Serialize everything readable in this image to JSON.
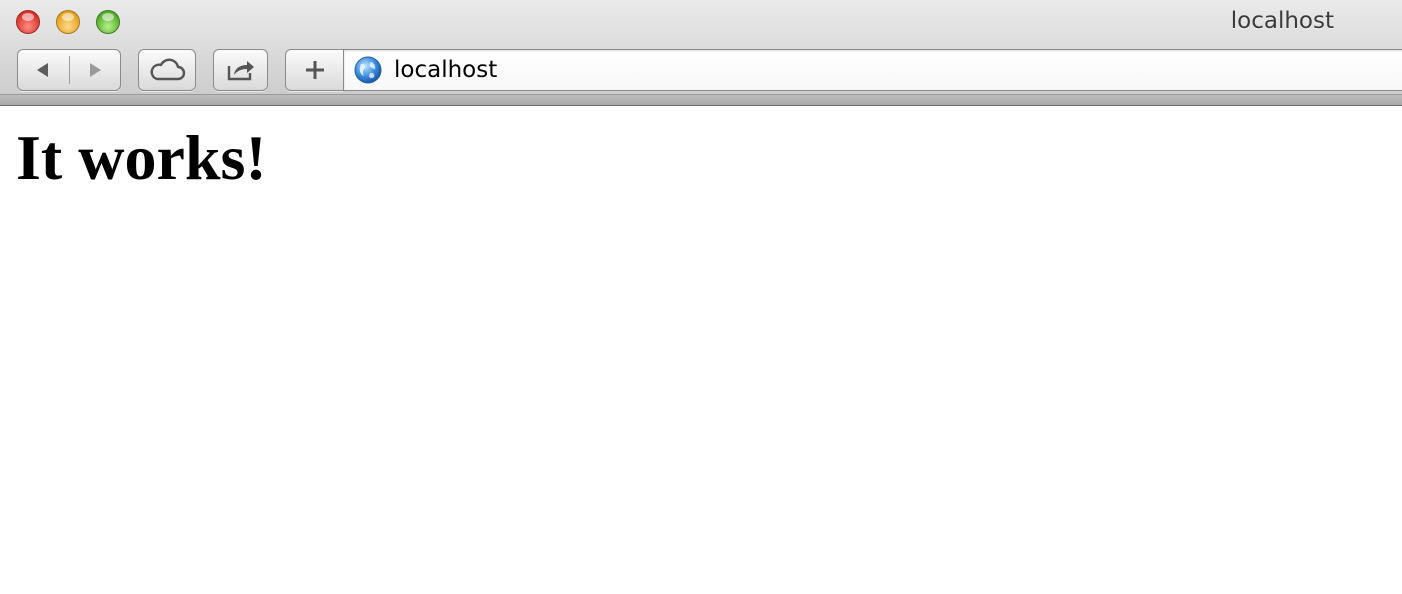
{
  "window": {
    "title": "localhost"
  },
  "toolbar": {
    "back_icon": "back-arrow-icon",
    "forward_icon": "forward-arrow-icon",
    "icloud_icon": "cloud-icon",
    "share_icon": "share-icon",
    "new_tab_icon": "plus-icon"
  },
  "address_bar": {
    "value": "localhost",
    "site_icon": "globe-icon"
  },
  "page": {
    "heading": "It works!"
  },
  "colors": {
    "close": "#d8322a",
    "minimize": "#e4a11b",
    "maximize": "#52a92c"
  }
}
